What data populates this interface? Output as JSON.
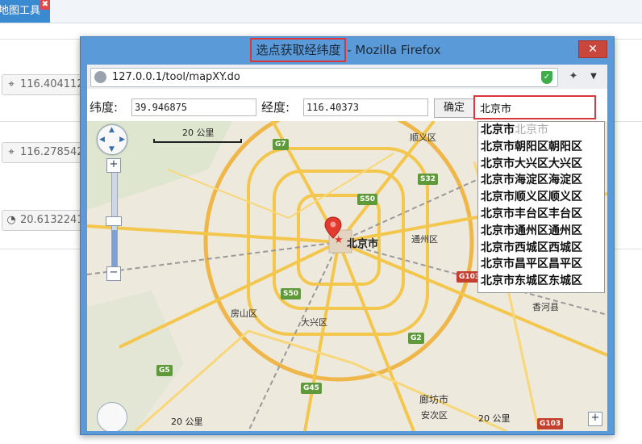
{
  "app": {
    "tab_label": "地图工具",
    "tab_close": "✖",
    "fields": [
      "116.404112",
      "116.278542",
      "20.6132241"
    ]
  },
  "window": {
    "title_highlight": "选点获取经纬度",
    "title_rest": " - Mozilla Firefox",
    "close": "✕"
  },
  "browser": {
    "url": "127.0.0.1/tool/mapXY.do"
  },
  "form": {
    "lat_label": "纬度:",
    "lat_value": "39.946875",
    "lng_label": "经度:",
    "lng_value": "116.40373",
    "confirm": "确定",
    "search_value": "北京市"
  },
  "suggestions": [
    {
      "main": "北京市",
      "sub": "北京市",
      "sub_gray": true
    },
    {
      "main": "北京市",
      "sub": "朝阳区朝阳区",
      "sub_gray": false
    },
    {
      "main": "北京市",
      "sub": "大兴区大兴区",
      "sub_gray": false
    },
    {
      "main": "北京市",
      "sub": "海淀区海淀区",
      "sub_gray": false
    },
    {
      "main": "北京市",
      "sub": "顺义区顺义区",
      "sub_gray": false
    },
    {
      "main": "北京市",
      "sub": "丰台区丰台区",
      "sub_gray": false
    },
    {
      "main": "北京市",
      "sub": "通州区通州区",
      "sub_gray": false
    },
    {
      "main": "北京市",
      "sub": "西城区西城区",
      "sub_gray": false
    },
    {
      "main": "北京市",
      "sub": "昌平区昌平区",
      "sub_gray": false
    },
    {
      "main": "北京市",
      "sub": "东城区东城区",
      "sub_gray": false
    }
  ],
  "map": {
    "scale_top": "20 公里",
    "scale_bottom": "20 公里",
    "scale_bottom_left": "20 公里",
    "labels": {
      "shunyi": "顺义区",
      "tongzhou": "通州区",
      "fangshan": "房山区",
      "daxing": "大兴区",
      "xianghe": "香河县",
      "langfang": "廊坊市",
      "anci": "安次区",
      "beijing": "北京市"
    },
    "roads": {
      "g7": "G7",
      "s32": "S32",
      "s50a": "S50",
      "s50b": "S50",
      "g103a": "G103",
      "g103b": "G103",
      "g2": "G2",
      "g5": "G5",
      "g45": "G45"
    }
  }
}
